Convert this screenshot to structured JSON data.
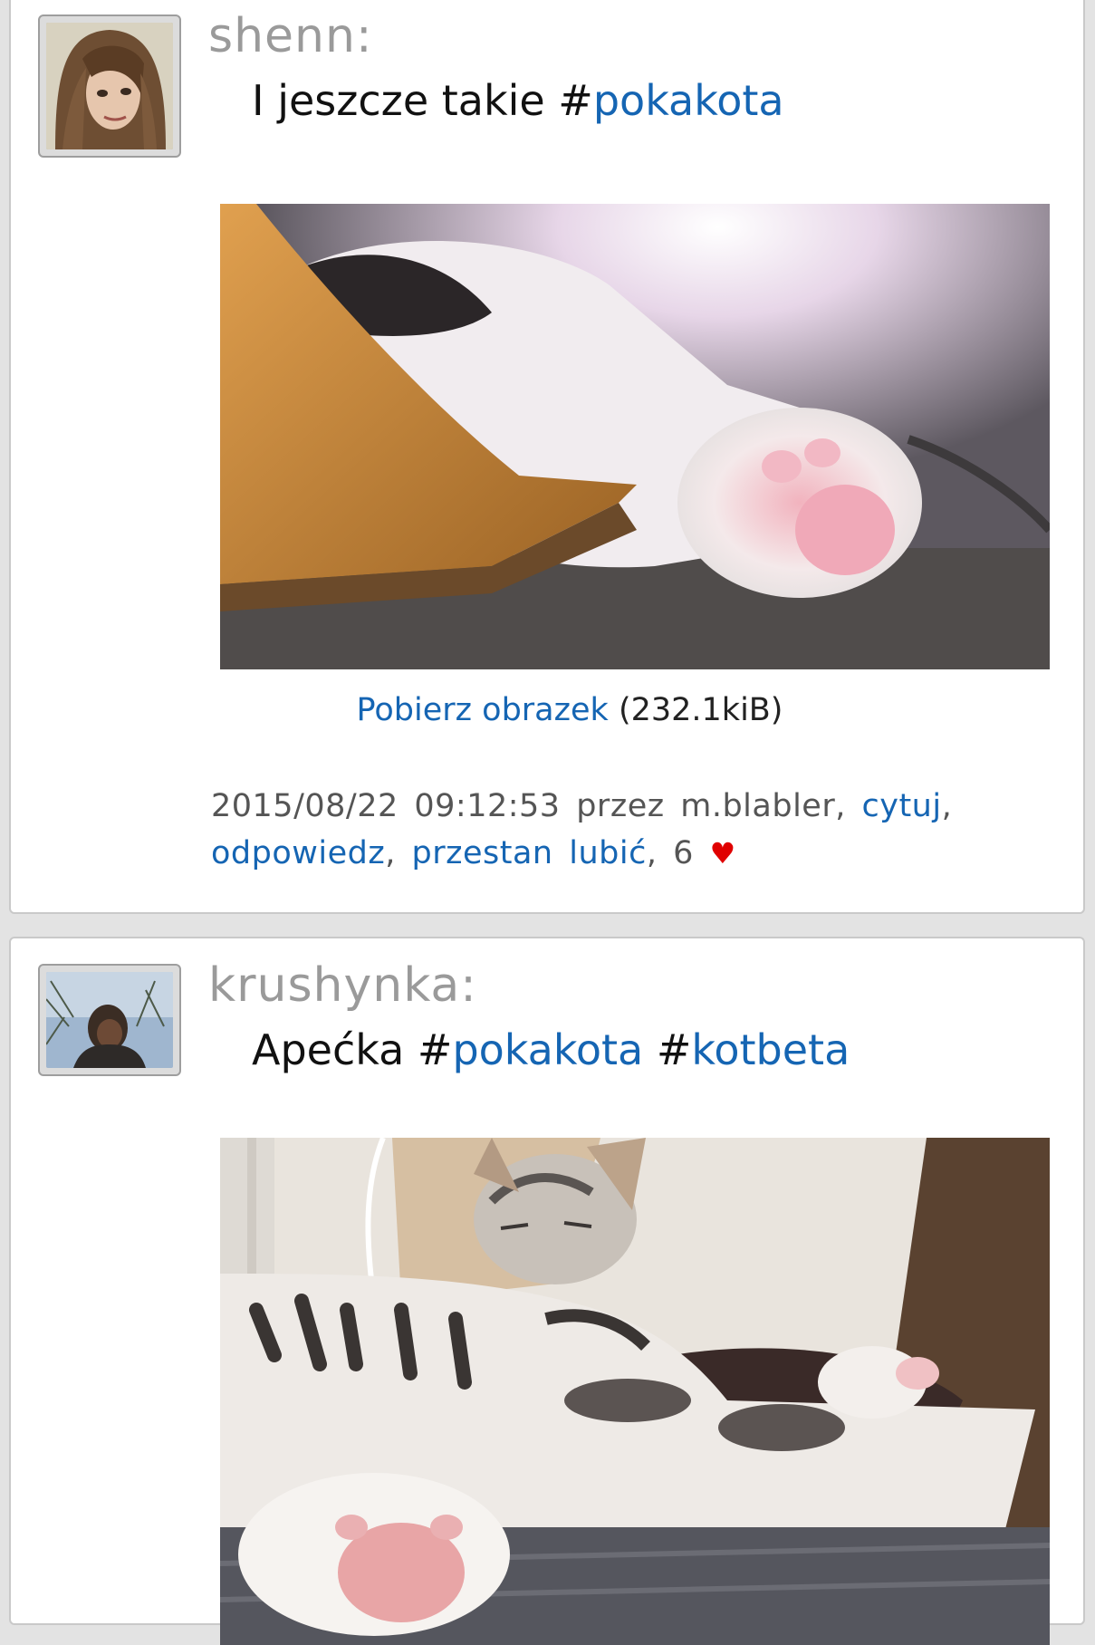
{
  "posts": [
    {
      "author": "shenn:",
      "text_prefix": "I jeszcze takie #",
      "tags": [
        "pokakota"
      ],
      "image_alt": "cat paw in sunlight",
      "download": {
        "link_label": "Pobierz obrazek",
        "size": "(232.1kiB)"
      },
      "meta": {
        "date": "2015/08/22",
        "time": "09:12:53",
        "by_label": "przez",
        "by_user": "m.blabler,",
        "quote_label": "cytuj",
        "reply_label": "odpowiedz",
        "unlike_label": "przestan lubić",
        "likes_count": "6",
        "heart": "♥"
      }
    },
    {
      "author": "krushynka:",
      "text_prefix": "Apećka #",
      "tags": [
        "pokakota",
        "kotbeta"
      ],
      "image_alt": "sleeping tabby cat"
    }
  ],
  "colors": {
    "link": "#1565b3",
    "author": "#9a9a9a",
    "heart": "#e00000",
    "background": "#e3e3e3"
  }
}
